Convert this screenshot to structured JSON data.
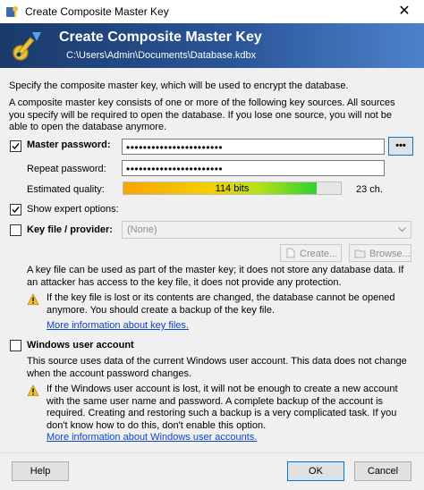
{
  "window": {
    "title": "Create Composite Master Key",
    "close_glyph": "✕"
  },
  "banner": {
    "heading": "Create Composite Master Key",
    "path": "C:\\Users\\Admin\\Documents\\Database.kdbx",
    "icon": "key-icon"
  },
  "intro": {
    "line1": "Specify the composite master key, which will be used to encrypt the database.",
    "line2": "A composite master key consists of one or more of the following key sources. All sources you specify will be required to open the database. If you lose one source, you will not be able to open the database anymore."
  },
  "master_password": {
    "label": "Master password:",
    "checked": true,
    "value": "•••••••••••••••••••••••",
    "reveal_label": "•••",
    "repeat_label": "Repeat password:",
    "repeat_value": "•••••••••••••••••••••••",
    "quality_label": "Estimated quality:",
    "quality_bits": "114 bits",
    "quality_fraction": 0.89,
    "char_count": "23 ch."
  },
  "expert": {
    "label": "Show expert options:",
    "checked": true
  },
  "keyfile": {
    "label": "Key file / provider:",
    "checked": false,
    "selected": "(None)",
    "create_label": "Create...",
    "browse_label": "Browse...",
    "desc": "A key file can be used as part of the master key; it does not store any database data. If an attacker has access to the key file, it does not provide any protection.",
    "warning": "If the key file is lost or its contents are changed, the database cannot be opened anymore. You should create a backup of the key file.",
    "link": "More information about key files."
  },
  "wua": {
    "label": "Windows user account",
    "checked": false,
    "desc": "This source uses data of the current Windows user account. This data does not change when the account password changes.",
    "warning": "If the Windows user account is lost, it will not be enough to create a new account with the same user name and password. A complete backup of the account is required. Creating and restoring such a backup is a very complicated task. If you don't know how to do this, don't enable this option.",
    "link": "More information about Windows user accounts."
  },
  "buttons": {
    "help": "Help",
    "ok": "OK",
    "cancel": "Cancel"
  },
  "colors": {
    "banner_start": "#1a3a6a",
    "banner_end": "#4d82cb",
    "link": "#0b46c8",
    "quality_low": "#f7a500",
    "quality_high": "#2fd12f"
  }
}
